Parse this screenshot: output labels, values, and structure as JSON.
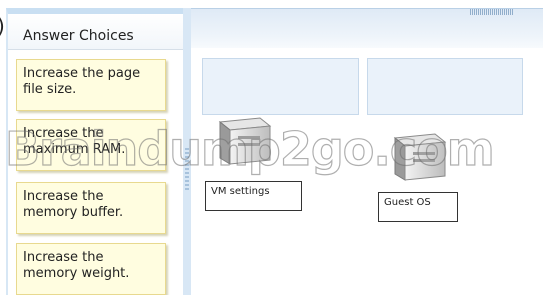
{
  "left_panel": {
    "title": "Answer Choices",
    "answers": [
      "Increase the page file size.",
      "Increase the maximum RAM.",
      "Increase the memory buffer.",
      "Increase the memory weight."
    ]
  },
  "right_panel": {
    "targets": [
      {
        "label": "VM settings"
      },
      {
        "label": "Guest OS"
      }
    ]
  },
  "watermark": "Braindump2go.com",
  "colors": {
    "card_fill": "#fffde0",
    "card_border": "#e8d98f",
    "panel_accent": "#c9dff2",
    "target_fill": "#eaf2fa"
  }
}
